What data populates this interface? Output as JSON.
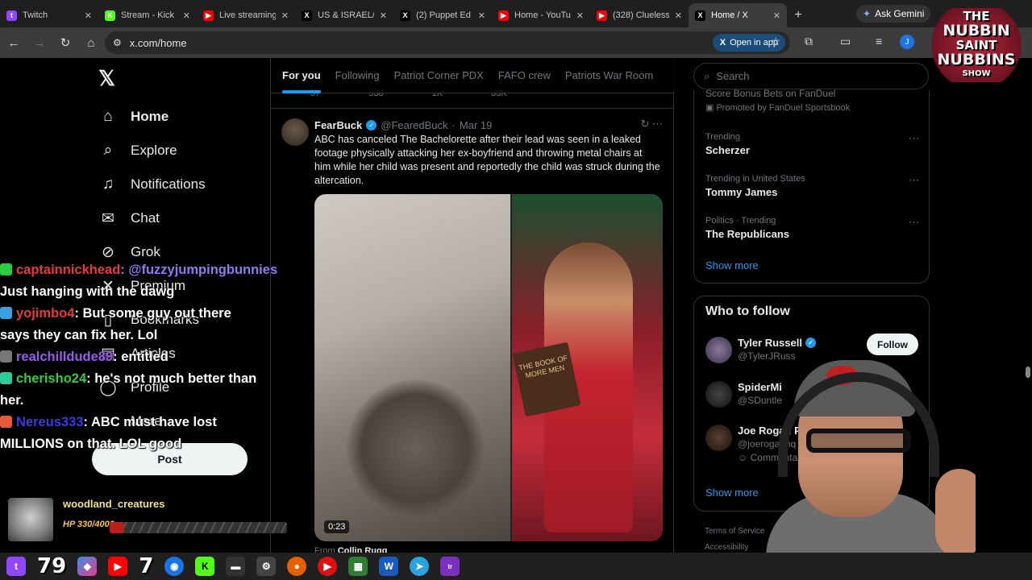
{
  "browser": {
    "tabs": [
      {
        "title": "Twitch",
        "icon": "twitch-icon",
        "color": "#9146ff",
        "glyph": "t"
      },
      {
        "title": "Stream - Kick",
        "icon": "kick-icon",
        "color": "#53fc18",
        "glyph": "K"
      },
      {
        "title": "Live streaming",
        "icon": "youtube-icon",
        "color": "#ff0000",
        "glyph": "▶"
      },
      {
        "title": "US & ISRAEL/",
        "icon": "x-icon",
        "color": "#000000",
        "glyph": "X"
      },
      {
        "title": "(2) Puppet Ed",
        "icon": "x-icon",
        "color": "#000000",
        "glyph": "X"
      },
      {
        "title": "Home - YouTu",
        "icon": "youtube-icon",
        "color": "#ff0000",
        "glyph": "▶"
      },
      {
        "title": "(328) Clueless",
        "icon": "youtube-icon",
        "color": "#ff0000",
        "glyph": "▶"
      },
      {
        "title": "Home / X",
        "icon": "x-icon",
        "color": "#000000",
        "glyph": "X",
        "active": true
      }
    ],
    "gemini_label": "Ask Gemini",
    "url": "x.com/home",
    "open_in_app": "Open in app",
    "profile_initial": "J"
  },
  "nav": {
    "items": [
      {
        "label": "Home",
        "icon": "home-icon",
        "glyph": "⌂"
      },
      {
        "label": "Explore",
        "icon": "search-icon",
        "glyph": "⌕"
      },
      {
        "label": "Notifications",
        "icon": "bell-icon",
        "glyph": "♫"
      },
      {
        "label": "Chat",
        "icon": "mail-icon",
        "glyph": "✉"
      },
      {
        "label": "Grok",
        "icon": "grok-icon",
        "glyph": "⊘"
      },
      {
        "label": "Premium",
        "icon": "premium-icon",
        "glyph": "✕"
      },
      {
        "label": "Bookmarks",
        "icon": "bookmark-icon",
        "glyph": "▯"
      },
      {
        "label": "Articles",
        "icon": "article-icon",
        "glyph": "▤"
      },
      {
        "label": "Profile",
        "icon": "profile-icon",
        "glyph": "◯"
      },
      {
        "label": "More",
        "icon": "more-icon",
        "glyph": "⋯"
      }
    ],
    "post_label": "Post"
  },
  "feed": {
    "tabs": [
      "For you",
      "Following",
      "Patriot Corner PDX",
      "FAFO crew",
      "Patriots War Room"
    ],
    "prev_stats": [
      "57",
      "538",
      "1K",
      "33K"
    ],
    "tweet": {
      "name": "FearBuck",
      "handle": "@FearedBuck",
      "date": "Mar 19",
      "text": "ABC has canceled The Bachelorette after their lead was seen in a leaked footage physically attacking her ex-boyfriend and throwing metal chairs at him while her child was present and reportedly the child was struck during the altercation.",
      "book_text": "THE BOOK OF MORE MEN",
      "duration": "0:23",
      "from_label": "From",
      "from_name": "Collin Rugg"
    }
  },
  "sidebar": {
    "search_placeholder": "Search",
    "promo_title": "Score Bonus Bets on FanDuel",
    "promo_by": "Promoted by FanDuel Sportsbook",
    "trends": [
      {
        "context": "Trending",
        "name": "Scherzer"
      },
      {
        "context": "Trending in United States",
        "name": "Tommy James"
      },
      {
        "context": "Politics · Trending",
        "name": "The Republicans"
      }
    ],
    "show_more": "Show more",
    "who_to_follow": "Who to follow",
    "accounts": [
      {
        "name": "Tyler Russell",
        "handle": "@TylerJRuss",
        "verified": true,
        "follow": "Follow"
      },
      {
        "name": "SpiderMi",
        "handle": "@SDuntle",
        "verified": false
      },
      {
        "name": "Joe Rogan Pod",
        "handle": "@joeroganhq",
        "sub": "Commentary",
        "verified": false
      }
    ],
    "show_more_2": "Show more",
    "footer": [
      "Terms of Service",
      "Accessibility"
    ]
  },
  "overlay": {
    "chat": [
      {
        "user": "captainnickhead",
        "color": "#e53a3a",
        "badge": "#2ecc40",
        "text": ": @fuzzyjumpingbunnies",
        "text_color": "#8a7cf0"
      },
      {
        "user": "",
        "color": "#fff",
        "badge": "",
        "text": "Just hanging with the dawg",
        "text_color": "#ffffff"
      },
      {
        "user": "yojimbo4",
        "color": "#e53a3a",
        "badge": "#3aa0e5",
        "text": ": But some guy out there",
        "text_color": "#ffffff"
      },
      {
        "user": "",
        "color": "#fff",
        "badge": "",
        "text": "says they can fix her. Lol",
        "text_color": "#ffffff"
      },
      {
        "user": "realchilldude89",
        "color": "#9b59f0",
        "badge": "#777777",
        "text": ": entitled",
        "text_color": "#ffffff"
      },
      {
        "user": "cherisho24",
        "color": "#2ecc40",
        "badge": "#2ecc9a",
        "text": ": he's not much better than",
        "text_color": "#ffffff"
      },
      {
        "user": "",
        "color": "#fff",
        "badge": "",
        "text": "her.",
        "text_color": "#ffffff"
      },
      {
        "user": "Nereus333",
        "color": "#3a3ae5",
        "badge": "#e55a3a",
        "text": ": ABC must have lost",
        "text_color": "#ffffff"
      },
      {
        "user": "",
        "color": "#fff",
        "badge": "",
        "text": "MILLIONS on that. LOL good",
        "text_color": "#ffffff"
      }
    ],
    "streamer": {
      "name": "woodland_creatures",
      "hp": "HP 330/4000",
      "hp_fraction": 0.0825
    },
    "logo": {
      "line1": "THE",
      "line2": "NUBBIN",
      "line3": "SAINT",
      "line4": "NUBBINS",
      "line5": "SHOW"
    },
    "taskbar_number": "79",
    "taskbar_number_2": "7"
  }
}
